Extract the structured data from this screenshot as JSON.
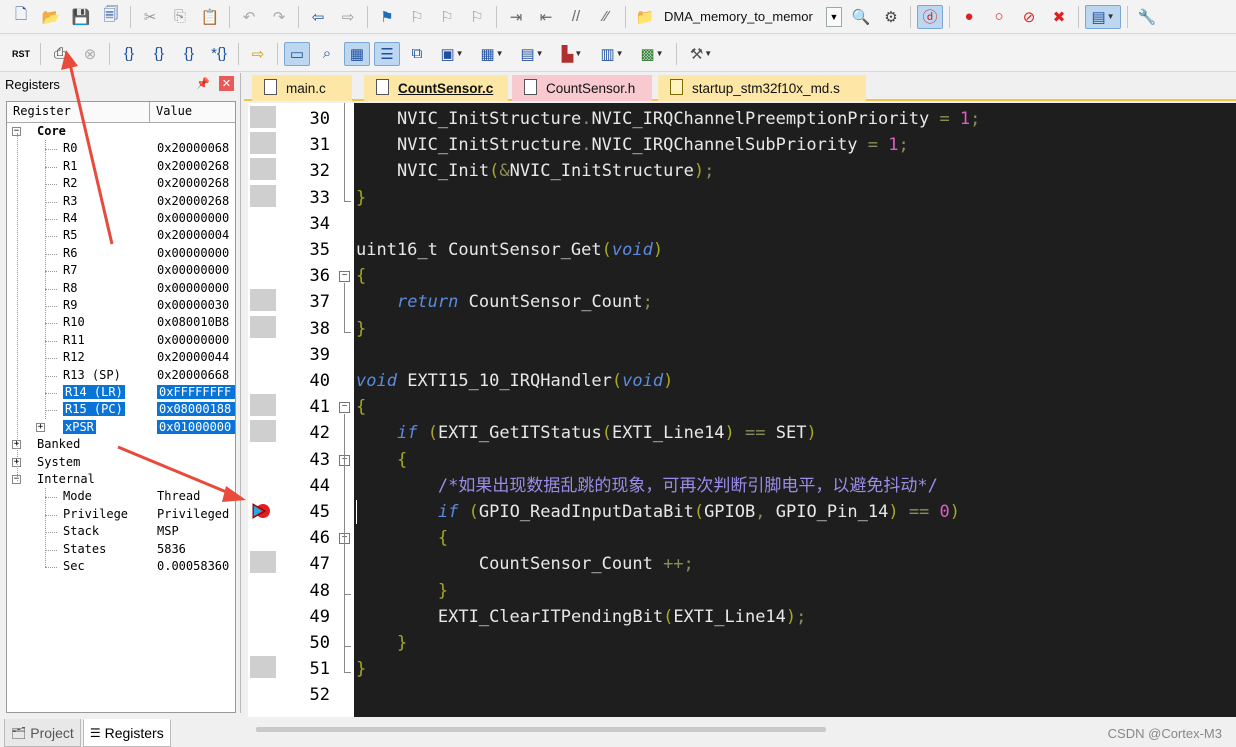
{
  "toolbar_top": {
    "target_combo": "DMA_memory_to_memor"
  },
  "registers_panel": {
    "title": "Registers",
    "col_register": "Register",
    "col_value": "Value",
    "groups": {
      "core": "Core",
      "banked": "Banked",
      "system": "System",
      "internal": "Internal"
    },
    "core": [
      {
        "name": "R0",
        "value": "0x20000068"
      },
      {
        "name": "R1",
        "value": "0x20000268"
      },
      {
        "name": "R2",
        "value": "0x20000268"
      },
      {
        "name": "R3",
        "value": "0x20000268"
      },
      {
        "name": "R4",
        "value": "0x00000000"
      },
      {
        "name": "R5",
        "value": "0x20000004"
      },
      {
        "name": "R6",
        "value": "0x00000000"
      },
      {
        "name": "R7",
        "value": "0x00000000"
      },
      {
        "name": "R8",
        "value": "0x00000000"
      },
      {
        "name": "R9",
        "value": "0x00000030"
      },
      {
        "name": "R10",
        "value": "0x080010B8"
      },
      {
        "name": "R11",
        "value": "0x00000000"
      },
      {
        "name": "R12",
        "value": "0x20000044"
      },
      {
        "name": "R13 (SP)",
        "value": "0x20000668"
      },
      {
        "name": "R14 (LR)",
        "value": "0xFFFFFFFF"
      },
      {
        "name": "R15 (PC)",
        "value": "0x08000188"
      },
      {
        "name": "xPSR",
        "value": "0x01000000"
      }
    ],
    "internal": [
      {
        "name": "Mode",
        "value": "Thread"
      },
      {
        "name": "Privilege",
        "value": "Privileged"
      },
      {
        "name": "Stack",
        "value": "MSP"
      },
      {
        "name": "States",
        "value": "5836"
      },
      {
        "name": "Sec",
        "value": "0.00058360"
      }
    ]
  },
  "bottom_tabs": {
    "project": "Project",
    "registers": "Registers"
  },
  "editor": {
    "tabs": [
      "main.c",
      "CountSensor.c",
      "CountSensor.h",
      "startup_stm32f10x_md.s"
    ],
    "active_tab": "CountSensor.c",
    "line_numbers": [
      "30",
      "31",
      "32",
      "33",
      "34",
      "35",
      "36",
      "37",
      "38",
      "39",
      "40",
      "41",
      "42",
      "43",
      "44",
      "45",
      "46",
      "47",
      "48",
      "49",
      "50",
      "51",
      "52"
    ],
    "code": {
      "l30_a": "NVIC_InitStructure",
      "l30_b": "NVIC_IRQChannelPreemptionPriority",
      "l30_v": "1",
      "l31_a": "NVIC_InitStructure",
      "l31_b": "NVIC_IRQChannelSubPriority",
      "l31_v": "1",
      "l32_a": "NVIC_Init",
      "l32_b": "NVIC_InitStructure",
      "l35_a": "uint16_t CountSensor_Get",
      "l35_k": "void",
      "l37_k": "return",
      "l37_a": "CountSensor_Count",
      "l40_k": "void",
      "l40_a": "EXTI15_10_IRQHandler",
      "l40_k2": "void",
      "l42_k": "if",
      "l42_a": "EXTI_GetITStatus",
      "l42_b": "EXTI_Line14",
      "l42_c": "SET",
      "l44_comment": "/*如果出现数据乱跳的现象，可再次判断引脚电平，以避免抖动*/",
      "l45_k": "if",
      "l45_a": "GPIO_ReadInputDataBit",
      "l45_b": "GPIOB",
      "l45_c": "GPIO_Pin_14",
      "l45_v": "0",
      "l47_a": "CountSensor_Count",
      "l49_a": "EXTI_ClearITPendingBit",
      "l49_b": "EXTI_Line14"
    }
  },
  "watermark": "CSDN @Cortex-M3"
}
